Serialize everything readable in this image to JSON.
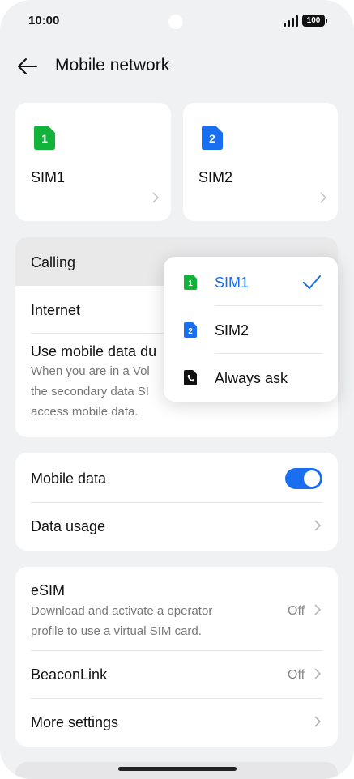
{
  "status_bar": {
    "time": "10:00",
    "battery": "100"
  },
  "header": {
    "title": "Mobile network"
  },
  "sim_cards": [
    {
      "badge": "1",
      "label": "SIM1",
      "color": "#12b33b"
    },
    {
      "badge": "2",
      "label": "SIM2",
      "color": "#1a6ef0"
    }
  ],
  "preferences": {
    "calling": "Calling",
    "internet": "Internet",
    "use_mobile_data_title": "Use mobile data du",
    "use_mobile_data_desc": [
      "When you are in a Vol",
      "the secondary data SI",
      "access mobile data."
    ]
  },
  "dropdown": {
    "items": [
      {
        "label": "SIM1",
        "selected": true
      },
      {
        "label": "SIM2",
        "selected": false
      },
      {
        "label": "Always ask",
        "selected": false
      }
    ]
  },
  "data_section": {
    "mobile_data": "Mobile data",
    "mobile_data_on": true,
    "data_usage": "Data usage"
  },
  "esim_section": {
    "esim_title": "eSIM",
    "esim_desc": [
      "Download and activate a operator",
      "profile to use a virtual SIM card."
    ],
    "esim_value": "Off",
    "beaconlink": "BeaconLink",
    "beaconlink_value": "Off",
    "more_settings": "More settings"
  },
  "colors": {
    "accent": "#1a6ef0",
    "sim1": "#12b33b",
    "background": "#f0f1f3"
  }
}
